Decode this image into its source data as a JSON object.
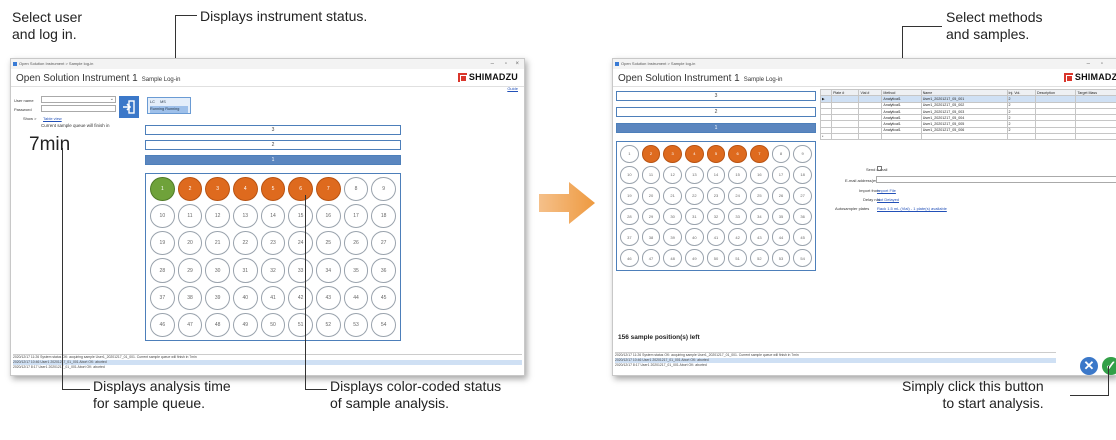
{
  "callouts": {
    "select_user": "Select user\nand log in.",
    "instrument_status": "Displays instrument status.",
    "analysis_time": "Displays analysis time\nfor sample queue.",
    "color_status": "Displays color-coded status\nof sample analysis.",
    "select_methods": "Select methods\nand samples.",
    "click_button": "Simply click this button\nto start analysis."
  },
  "left_window": {
    "titlebar": "Open Solution Instrument > Sample log-in",
    "app_title": "Open Solution Instrument 1",
    "app_subtitle": "Sample Log-in",
    "logo_text": "SHIMADZU",
    "guide_link": "Guide",
    "user_label": "User name",
    "password_label": "Password",
    "show_label": "Show >",
    "table_view_link": "Table view",
    "queue_label": "Current sample queue will finish in",
    "queue_time": "7min",
    "status_item1": "LC",
    "status_item1_state": "Running",
    "status_item2": "MS",
    "status_item2_state": "Running",
    "racks": [
      "3",
      "2",
      "1"
    ],
    "selected_rack": 2,
    "vials": [
      {
        "n": "1",
        "s": "green"
      },
      {
        "n": "2",
        "s": "orange"
      },
      {
        "n": "3",
        "s": "orange"
      },
      {
        "n": "4",
        "s": "orange"
      },
      {
        "n": "5",
        "s": "orange"
      },
      {
        "n": "6",
        "s": "orange"
      },
      {
        "n": "7",
        "s": "orange"
      },
      {
        "n": "8",
        "s": ""
      },
      {
        "n": "9",
        "s": ""
      },
      {
        "n": "10",
        "s": ""
      },
      {
        "n": "11",
        "s": ""
      },
      {
        "n": "12",
        "s": ""
      },
      {
        "n": "13",
        "s": ""
      },
      {
        "n": "14",
        "s": ""
      },
      {
        "n": "15",
        "s": ""
      },
      {
        "n": "16",
        "s": ""
      },
      {
        "n": "17",
        "s": ""
      },
      {
        "n": "18",
        "s": ""
      },
      {
        "n": "19",
        "s": ""
      },
      {
        "n": "20",
        "s": ""
      },
      {
        "n": "21",
        "s": ""
      },
      {
        "n": "22",
        "s": ""
      },
      {
        "n": "23",
        "s": ""
      },
      {
        "n": "24",
        "s": ""
      },
      {
        "n": "25",
        "s": ""
      },
      {
        "n": "26",
        "s": ""
      },
      {
        "n": "27",
        "s": ""
      },
      {
        "n": "28",
        "s": ""
      },
      {
        "n": "29",
        "s": ""
      },
      {
        "n": "30",
        "s": ""
      },
      {
        "n": "31",
        "s": ""
      },
      {
        "n": "32",
        "s": ""
      },
      {
        "n": "33",
        "s": ""
      },
      {
        "n": "34",
        "s": ""
      },
      {
        "n": "35",
        "s": ""
      },
      {
        "n": "36",
        "s": ""
      },
      {
        "n": "37",
        "s": ""
      },
      {
        "n": "38",
        "s": ""
      },
      {
        "n": "39",
        "s": ""
      },
      {
        "n": "40",
        "s": ""
      },
      {
        "n": "41",
        "s": ""
      },
      {
        "n": "42",
        "s": ""
      },
      {
        "n": "43",
        "s": ""
      },
      {
        "n": "44",
        "s": ""
      },
      {
        "n": "45",
        "s": ""
      },
      {
        "n": "46",
        "s": ""
      },
      {
        "n": "47",
        "s": ""
      },
      {
        "n": "48",
        "s": ""
      },
      {
        "n": "49",
        "s": ""
      },
      {
        "n": "50",
        "s": ""
      },
      {
        "n": "51",
        "s": ""
      },
      {
        "n": "52",
        "s": ""
      },
      {
        "n": "53",
        "s": ""
      },
      {
        "n": "54",
        "s": ""
      }
    ],
    "log_lines": [
      "2020/12/17 11:26 System status OK: acquiring sample User1_20201217_01_001. Current sample queue will finish in 7min",
      "2020/12/17 10:46 User1 20201217_01_001 Abort OK: aborted",
      "2020/12/17 8:17 User1 20201217_01_001 Abort OK: aborted"
    ]
  },
  "right_window": {
    "titlebar": "Open Solution Instrument > Sample log-in",
    "app_title": "Open Solution Instrument 1",
    "app_subtitle": "Sample Log-in",
    "logo_text": "SHIMADZU",
    "racks": [
      "3",
      "2",
      "1"
    ],
    "selected_rack": 2,
    "vials": [
      {
        "n": "1",
        "s": ""
      },
      {
        "n": "2",
        "s": "orange"
      },
      {
        "n": "3",
        "s": "orange"
      },
      {
        "n": "4",
        "s": "orange"
      },
      {
        "n": "5",
        "s": "orange"
      },
      {
        "n": "6",
        "s": "orange"
      },
      {
        "n": "7",
        "s": "orange"
      },
      {
        "n": "8",
        "s": ""
      },
      {
        "n": "9",
        "s": ""
      },
      {
        "n": "10",
        "s": ""
      },
      {
        "n": "11",
        "s": ""
      },
      {
        "n": "12",
        "s": ""
      },
      {
        "n": "13",
        "s": ""
      },
      {
        "n": "14",
        "s": ""
      },
      {
        "n": "15",
        "s": ""
      },
      {
        "n": "16",
        "s": ""
      },
      {
        "n": "17",
        "s": ""
      },
      {
        "n": "18",
        "s": ""
      },
      {
        "n": "19",
        "s": ""
      },
      {
        "n": "20",
        "s": ""
      },
      {
        "n": "21",
        "s": ""
      },
      {
        "n": "22",
        "s": ""
      },
      {
        "n": "23",
        "s": ""
      },
      {
        "n": "24",
        "s": ""
      },
      {
        "n": "25",
        "s": ""
      },
      {
        "n": "26",
        "s": ""
      },
      {
        "n": "27",
        "s": ""
      },
      {
        "n": "28",
        "s": ""
      },
      {
        "n": "29",
        "s": ""
      },
      {
        "n": "30",
        "s": ""
      },
      {
        "n": "31",
        "s": ""
      },
      {
        "n": "32",
        "s": ""
      },
      {
        "n": "33",
        "s": ""
      },
      {
        "n": "34",
        "s": ""
      },
      {
        "n": "35",
        "s": ""
      },
      {
        "n": "36",
        "s": ""
      },
      {
        "n": "37",
        "s": ""
      },
      {
        "n": "38",
        "s": ""
      },
      {
        "n": "39",
        "s": ""
      },
      {
        "n": "40",
        "s": ""
      },
      {
        "n": "41",
        "s": ""
      },
      {
        "n": "42",
        "s": ""
      },
      {
        "n": "43",
        "s": ""
      },
      {
        "n": "44",
        "s": ""
      },
      {
        "n": "45",
        "s": ""
      },
      {
        "n": "46",
        "s": ""
      },
      {
        "n": "47",
        "s": ""
      },
      {
        "n": "48",
        "s": ""
      },
      {
        "n": "49",
        "s": ""
      },
      {
        "n": "50",
        "s": ""
      },
      {
        "n": "51",
        "s": ""
      },
      {
        "n": "52",
        "s": ""
      },
      {
        "n": "53",
        "s": ""
      },
      {
        "n": "54",
        "s": ""
      }
    ],
    "table_headers": [
      "",
      "Plate #",
      "Vial #",
      "Method",
      "Name",
      "Inj. Vol.",
      "Description",
      "Target Mass"
    ],
    "table_rows": [
      [
        "▶",
        "",
        "",
        "Analytical1",
        "User1_20201217_05_001",
        "2",
        "",
        ""
      ],
      [
        "",
        "",
        "",
        "Analytical1",
        "User1_20201217_05_002",
        "2",
        "",
        ""
      ],
      [
        "",
        "",
        "",
        "Analytical1",
        "User1_20201217_05_003",
        "2",
        "",
        ""
      ],
      [
        "",
        "",
        "",
        "Analytical1",
        "User1_20201217_05_004",
        "2",
        "",
        ""
      ],
      [
        "",
        "",
        "",
        "Analytical1",
        "User1_20201217_05_005",
        "2",
        "",
        ""
      ],
      [
        "",
        "",
        "",
        "Analytical1",
        "User1_20201217_05_006",
        "2",
        "",
        ""
      ],
      [
        "*",
        "",
        "",
        "",
        "",
        "",
        "",
        ""
      ]
    ],
    "form": {
      "send_email": "Send e-mail",
      "email_address": "E-mail address(es)",
      "import_from": "Import from",
      "import_link": "Import File",
      "delay_run": "Delay run",
      "delay_link": "Not Delayed",
      "autosampler_plates": "Autosampler plates",
      "plates_link": "Rack 1.5 mL (Vial) - 1 plate(s) available"
    },
    "positions_left": "156 sample position(s) left",
    "log_lines": [
      "2020/12/17 11:26 System status OK: acquiring sample User1_20201217_01_001. Current sample queue will finish in 7min",
      "2020/12/17 10:46 User1 20201217_01_001 Abort OK: aborted",
      "2020/12/17 8:17 User1 20201217_01_001 Abort OK: aborted"
    ]
  },
  "colors": {
    "orange": "#de6a1e",
    "green": "#6fa23a",
    "blue": "#3b78c9",
    "ok": "#33a048",
    "arrow": "#f0a050"
  }
}
